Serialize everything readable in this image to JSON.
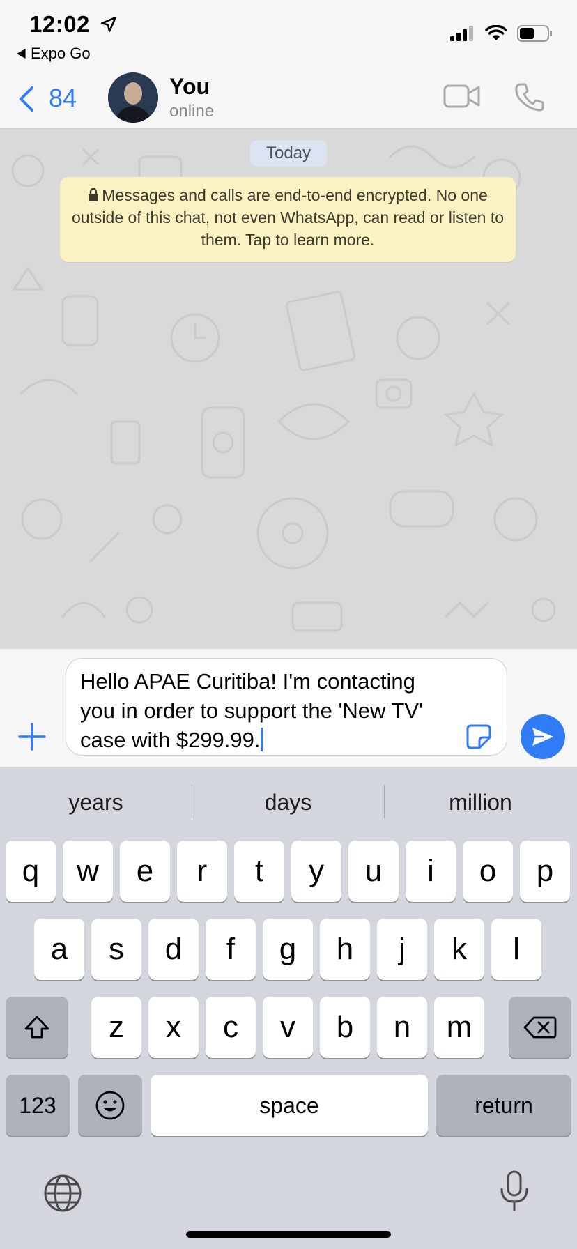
{
  "status_bar": {
    "time": "12:02",
    "back_app": "Expo Go"
  },
  "header": {
    "back_count": "84",
    "contact_name": "You",
    "contact_status": "online"
  },
  "chat": {
    "date_label": "Today",
    "encryption_notice": "Messages and calls are end-to-end encrypted. No one outside of this chat, not even WhatsApp, can read or listen to them. Tap to learn more."
  },
  "composer": {
    "message_text": "Hello APAE Curitiba! I'm contacting you in order to support the 'New TV' case with $299.99."
  },
  "keyboard": {
    "suggestions": [
      "years",
      "days",
      "million"
    ],
    "row1": [
      "q",
      "w",
      "e",
      "r",
      "t",
      "y",
      "u",
      "i",
      "o",
      "p"
    ],
    "row2": [
      "a",
      "s",
      "d",
      "f",
      "g",
      "h",
      "j",
      "k",
      "l"
    ],
    "row3": [
      "z",
      "x",
      "c",
      "v",
      "b",
      "n",
      "m"
    ],
    "numbers_label": "123",
    "space_label": "space",
    "return_label": "return"
  },
  "colors": {
    "accent": "#2f7cf6",
    "chat_bg": "#d9d9d9",
    "notice_bg": "#fbf2c4"
  }
}
